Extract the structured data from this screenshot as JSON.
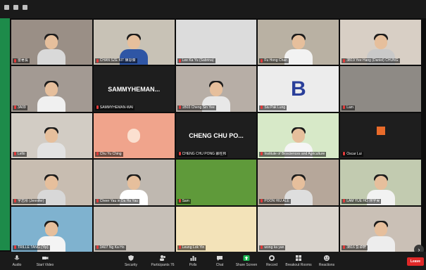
{
  "participants": [
    {
      "name": "雷著長"
    },
    {
      "name": "CHAN SZE KIT 陳思傑"
    },
    {
      "name": "Lee Ka Yu (Sabrina)"
    },
    {
      "name": "Fu Hong Chan"
    },
    {
      "name": "3B19 Yee Hang (Daniel) CHUNG"
    },
    {
      "name": "3A09"
    },
    {
      "name": "SAMMYHEMAN-WAI",
      "display_text": "SAMMYHEMAN..."
    },
    {
      "name": "1B03 Cheng Sin Yee"
    },
    {
      "name": "Siu Pak Lung"
    },
    {
      "name": "Lam"
    },
    {
      "name": "Lello"
    },
    {
      "name": "Chu Yu Ching"
    },
    {
      "name": "CHENG CHU PONG 鄭柱邦",
      "display_text": "CHENG CHU PO..."
    },
    {
      "name": "Institute of Biosciences and Agriculture"
    },
    {
      "name": "Oscar Lui"
    },
    {
      "name": "宇志彤 (Jennifer)"
    },
    {
      "name": "Cheer Yau in Da Ha Yau"
    },
    {
      "name": "Sam"
    },
    {
      "name": "POON HIU ALE"
    },
    {
      "name": "LAM YUE HO 林宇昊"
    },
    {
      "name": "TRILLE TANG (Yip)"
    },
    {
      "name": "3A07 Ng Ka Ho"
    },
    {
      "name": "Leung Lok Yin"
    },
    {
      "name": "wong ka yan"
    },
    {
      "name": "3B16 彭卓軒"
    }
  ],
  "toolbar": [
    {
      "label": "Audio",
      "icon": "microphone-icon"
    },
    {
      "label": "Start Video",
      "icon": "video-camera-icon"
    },
    {
      "label": "Security",
      "icon": "shield-icon"
    },
    {
      "label": "Participants",
      "icon": "participants-icon",
      "count": "76"
    },
    {
      "label": "Polls",
      "icon": "polls-icon"
    },
    {
      "label": "Chat",
      "icon": "chat-icon"
    },
    {
      "label": "Share Screen",
      "icon": "share-screen-icon"
    },
    {
      "label": "Record",
      "icon": "record-icon"
    },
    {
      "label": "Breakout Rooms",
      "icon": "breakout-rooms-icon"
    },
    {
      "label": "Reactions",
      "icon": "reactions-icon"
    }
  ],
  "end_label": "Leave",
  "colors": {
    "share_green": "#1db954",
    "end_red": "#e02828",
    "mic_red": "#e23b3b"
  }
}
